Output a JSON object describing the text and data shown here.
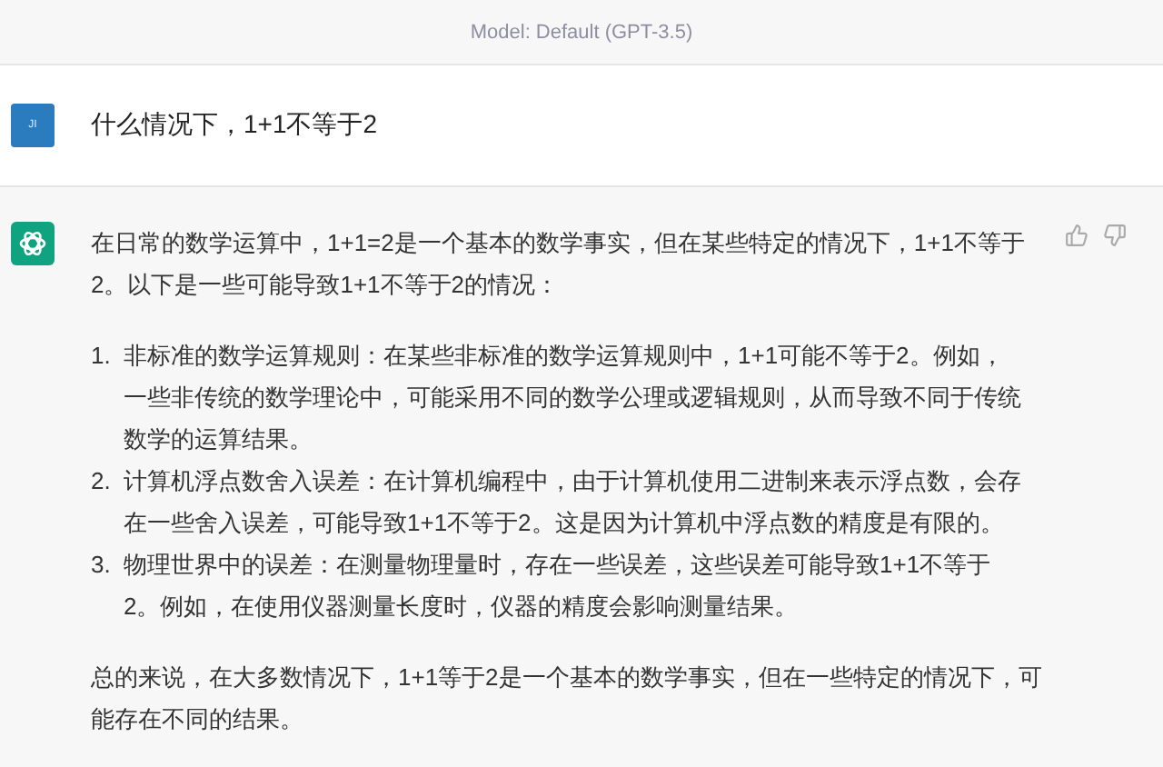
{
  "header": {
    "model": "Model: Default (GPT-3.5)"
  },
  "user_message": {
    "avatar": "JI",
    "text": "什么情况下，1+1不等于2"
  },
  "assistant_message": {
    "intro": "在日常的数学运算中，1+1=2是一个基本的数学事实，但在某些特定的情况下，1+1不等于2。以下是一些可能导致1+1不等于2的情况：",
    "items": [
      {
        "number": "1.",
        "text": "非标准的数学运算规则：在某些非标准的数学运算规则中，1+1可能不等于2。例如，一些非传统的数学理论中，可能采用不同的数学公理或逻辑规则，从而导致不同于传统数学的运算结果。"
      },
      {
        "number": "2.",
        "text": "计算机浮点数舍入误差：在计算机编程中，由于计算机使用二进制来表示浮点数，会存在一些舍入误差，可能导致1+1不等于2。这是因为计算机中浮点数的精度是有限的。"
      },
      {
        "number": "3.",
        "text": "物理世界中的误差：在测量物理量时，存在一些误差，这些误差可能导致1+1不等于2。例如，在使用仪器测量长度时，仪器的精度会影响测量结果。"
      }
    ],
    "conclusion": "总的来说，在大多数情况下，1+1等于2是一个基本的数学事实，但在一些特定的情况下，可能存在不同的结果。"
  }
}
